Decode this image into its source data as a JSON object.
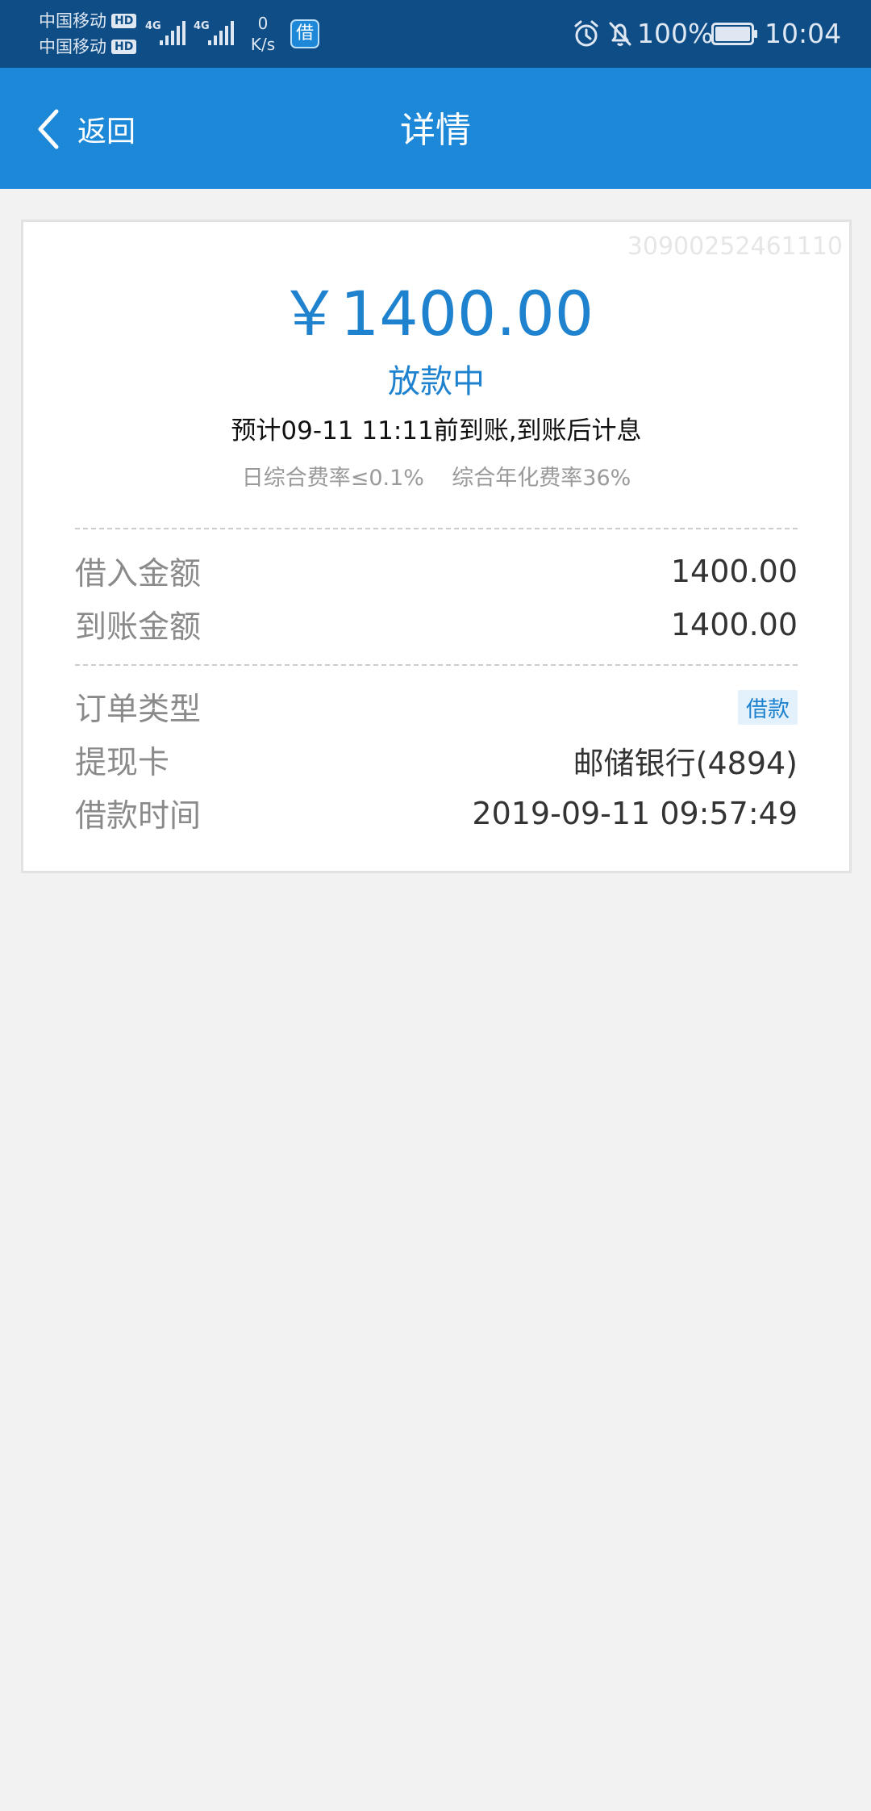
{
  "status_bar": {
    "carrier_1": "中国移动",
    "carrier_2": "中国移动",
    "hd_label": "HD",
    "network_type": "4G",
    "net_speed_value": "0",
    "net_speed_unit": "K/s",
    "app_badge": "借",
    "battery_percent": "100%",
    "battery_level": 1.0,
    "time": "10:04",
    "icons": [
      "signal-icon",
      "alarm-icon",
      "bell-off-icon",
      "battery-icon"
    ]
  },
  "nav": {
    "back_label": "返回",
    "title": "详情",
    "back_icon": "chevron-left-icon"
  },
  "detail": {
    "order_no": "30900252461110",
    "amount": "￥1400.00",
    "status": "放款中",
    "eta": "预计09-11 11:11前到账,到账后计息",
    "rates": "日综合费率≤0.1%    综合年化费率36%",
    "rows_group_1": [
      {
        "label": "借入金额",
        "value": "1400.00"
      },
      {
        "label": "到账金额",
        "value": "1400.00"
      }
    ],
    "rows_group_2": [
      {
        "label": "订单类型",
        "value": "借款",
        "is_tag": true
      },
      {
        "label": "提现卡",
        "value": "邮储银行(4894)"
      },
      {
        "label": "借款时间",
        "value": "2019-09-11 09:57:49"
      }
    ]
  },
  "colors": {
    "status_bar_bg": "#0f4d86",
    "nav_bg": "#1d87d8",
    "accent": "#1e82cf",
    "page_bg": "#f2f2f2"
  }
}
